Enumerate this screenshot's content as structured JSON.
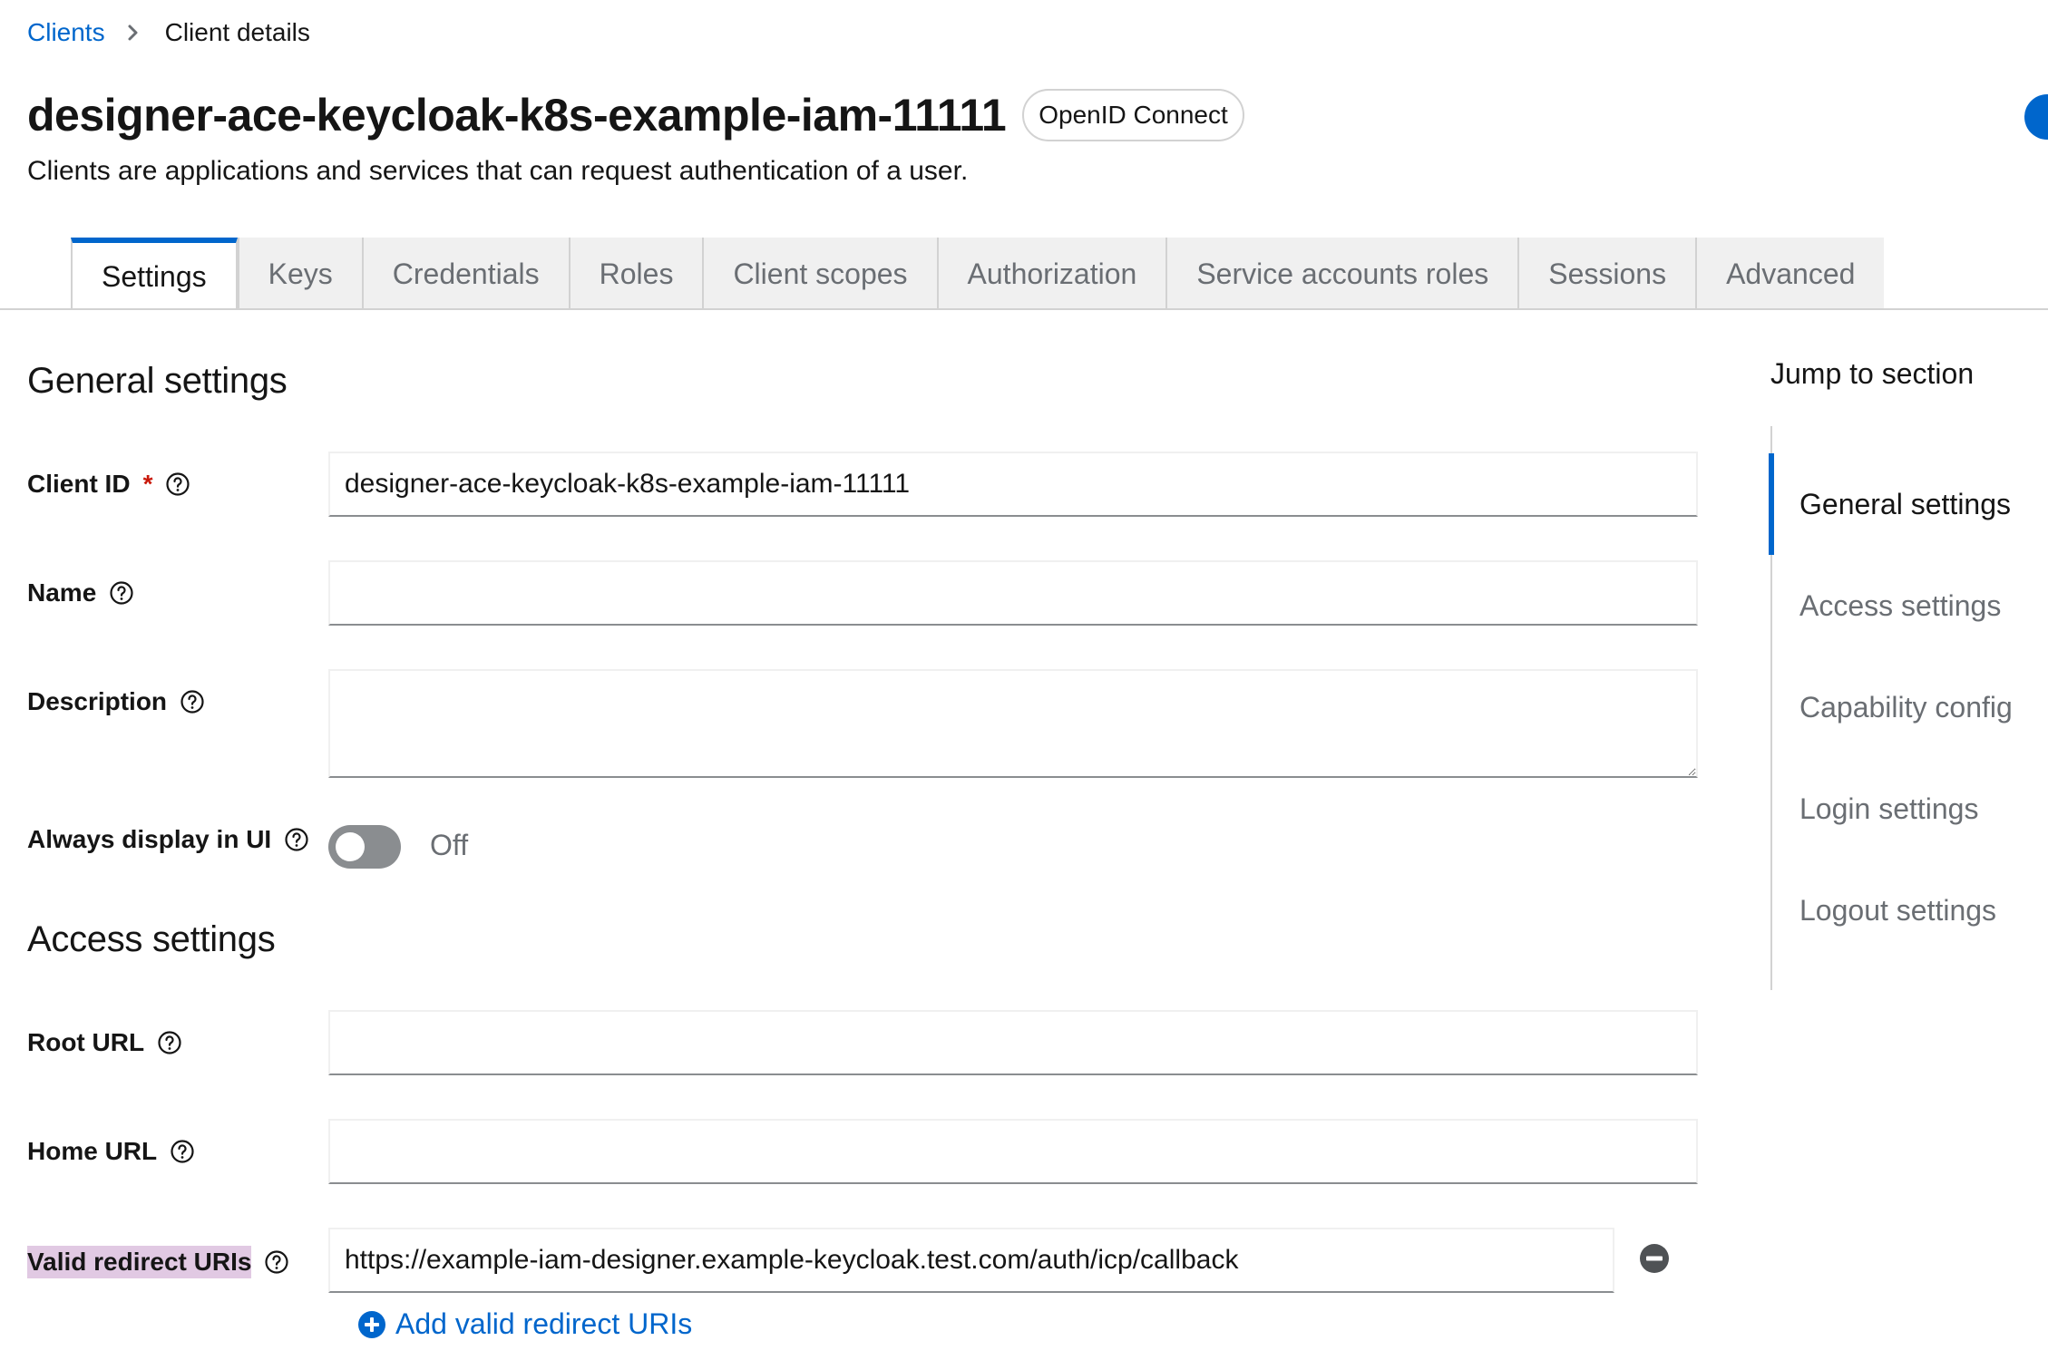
{
  "breadcrumb": {
    "parent": "Clients",
    "current": "Client details"
  },
  "header": {
    "title": "designer-ace-keycloak-k8s-example-iam-11111",
    "protocol_badge": "OpenID Connect",
    "subtitle": "Clients are applications and services that can request authentication of a user."
  },
  "tabs": [
    {
      "label": "Settings",
      "active": true
    },
    {
      "label": "Keys"
    },
    {
      "label": "Credentials"
    },
    {
      "label": "Roles"
    },
    {
      "label": "Client scopes"
    },
    {
      "label": "Authorization"
    },
    {
      "label": "Service accounts roles"
    },
    {
      "label": "Sessions"
    },
    {
      "label": "Advanced"
    }
  ],
  "general": {
    "heading": "General settings",
    "client_id": {
      "label": "Client ID",
      "required_mark": "*",
      "value": "designer-ace-keycloak-k8s-example-iam-11111"
    },
    "name": {
      "label": "Name",
      "value": ""
    },
    "description": {
      "label": "Description",
      "value": ""
    },
    "always_display": {
      "label": "Always display in UI",
      "state": "Off",
      "enabled": false
    }
  },
  "access": {
    "heading": "Access settings",
    "root_url": {
      "label": "Root URL",
      "value": ""
    },
    "home_url": {
      "label": "Home URL",
      "value": ""
    },
    "redirect_uris": {
      "label": "Valid redirect URIs",
      "value": "https://example-iam-designer.example-keycloak.test.com/auth/icp/callback",
      "add_label": "Add valid redirect URIs"
    }
  },
  "jump": {
    "title": "Jump to section",
    "items": [
      {
        "label": "General settings",
        "active": true
      },
      {
        "label": "Access settings"
      },
      {
        "label": "Capability config"
      },
      {
        "label": "Login settings"
      },
      {
        "label": "Logout settings"
      }
    ]
  },
  "colors": {
    "link": "#0066cc",
    "highlight": "#e1c9e3",
    "required": "#c9190b",
    "toggle_off": "#8a8d90"
  }
}
